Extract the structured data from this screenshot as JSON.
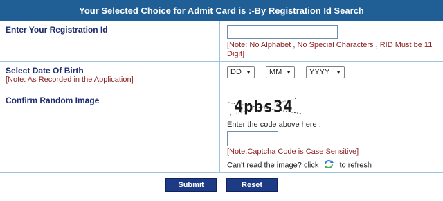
{
  "header": {
    "title": "Your Selected Choice for Admit Card is :-By Registration Id Search"
  },
  "registration": {
    "label": "Enter Your Registration Id",
    "value": "",
    "note": "[Note: No Alphabet , No Special Characters , RID Must be 11 Digit]"
  },
  "dob": {
    "label": "Select Date Of Birth",
    "note": "[Note: As Recorded in the Application]",
    "day": "DD",
    "month": "MM",
    "year": "YYYY"
  },
  "captcha": {
    "label": "Confirm Random Image",
    "code": "4pbs34",
    "enter_label": "Enter the code above here :",
    "value": "",
    "note": "[Note:Captcha Code is Case Sensitive]",
    "cant_read_prefix": "Can't read the image? click",
    "cant_read_suffix": "to refresh",
    "refresh_icon": "refresh-icon"
  },
  "buttons": {
    "submit": "Submit",
    "reset": "Reset"
  },
  "colors": {
    "header_bg": "#1f5f96",
    "button_bg": "#1d3a85",
    "label": "#1e2b6e",
    "note": "#8b1f1f",
    "border": "#9cc4e4"
  }
}
